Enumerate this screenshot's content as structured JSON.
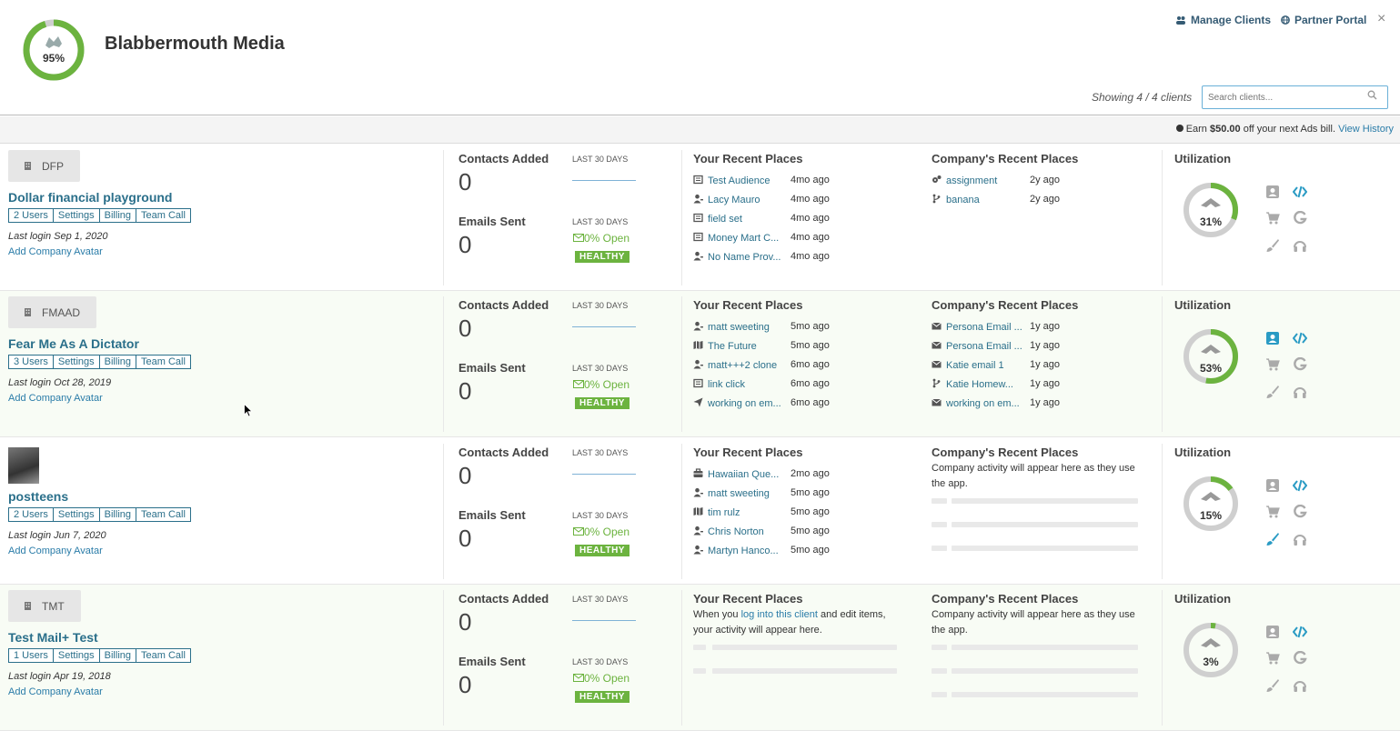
{
  "header": {
    "overall_percent_label": "95%",
    "overall_percent": 95,
    "company": "Blabbermouth Media",
    "manage_clients": "Manage Clients",
    "partner_portal": "Partner Portal",
    "close": "×",
    "showing": "Showing 4 / 4 clients",
    "search_placeholder": "Search clients..."
  },
  "earn_bar": {
    "prefix": "Earn ",
    "amount": "$50.00",
    "suffix": " off your next Ads bill. ",
    "link": "View History"
  },
  "labels": {
    "contacts_added": "Contacts Added",
    "emails_sent": "Emails Sent",
    "last_30_days": "LAST 30 DAYS",
    "your_recent_places": "Your Recent Places",
    "company_recent_places": "Company's Recent Places",
    "utilization": "Utilization",
    "add_company_avatar": "Add Company Avatar",
    "settings": "Settings",
    "billing": "Billing",
    "team_call": "Team Call",
    "healthy": "HEALTHY",
    "open_rate": "0% Open",
    "empty_company": "Company activity will appear here as they use the app.",
    "empty_your_prefix": "When you ",
    "empty_your_link": "log into this client",
    "empty_your_suffix": " and edit items, your activity will appear here."
  },
  "clients": [
    {
      "badge": "DFP",
      "name": "Dollar financial playground",
      "users": "2 Users",
      "last_login": "Last login Sep 1, 2020",
      "contacts": "0",
      "emails": "0",
      "utilization_label": "31%",
      "utilization": 31,
      "your_places": [
        {
          "icon": "list-icon",
          "label": "Test Audience",
          "ago": "4mo ago"
        },
        {
          "icon": "person-icon",
          "label": "Lacy Mauro",
          "ago": "4mo ago"
        },
        {
          "icon": "list-icon",
          "label": "field set",
          "ago": "4mo ago"
        },
        {
          "icon": "list-icon",
          "label": "Money Mart C...",
          "ago": "4mo ago"
        },
        {
          "icon": "person-icon",
          "label": "No Name Prov...",
          "ago": "4mo ago"
        }
      ],
      "company_places": [
        {
          "icon": "gears-icon",
          "label": "assignment",
          "ago": "2y ago"
        },
        {
          "icon": "branch-icon",
          "label": "banana",
          "ago": "2y ago"
        }
      ]
    },
    {
      "badge": "FMAAD",
      "name": "Fear Me As A Dictator",
      "users": "3 Users",
      "last_login": "Last login Oct 28, 2019",
      "contacts": "0",
      "emails": "0",
      "utilization_label": "53%",
      "utilization": 53,
      "your_places": [
        {
          "icon": "person-icon",
          "label": "matt sweeting",
          "ago": "5mo ago"
        },
        {
          "icon": "map-icon",
          "label": "The Future",
          "ago": "5mo ago"
        },
        {
          "icon": "person-icon",
          "label": "matt+++2 clone",
          "ago": "6mo ago"
        },
        {
          "icon": "list-icon",
          "label": "link click",
          "ago": "6mo ago"
        },
        {
          "icon": "send-icon",
          "label": "working on em...",
          "ago": "6mo ago"
        }
      ],
      "company_places": [
        {
          "icon": "envelope-icon",
          "label": "Persona Email ...",
          "ago": "1y ago"
        },
        {
          "icon": "envelope-icon",
          "label": "Persona Email ...",
          "ago": "1y ago"
        },
        {
          "icon": "envelope-icon",
          "label": "Katie email 1",
          "ago": "1y ago"
        },
        {
          "icon": "branch-icon",
          "label": "Katie Homew...",
          "ago": "1y ago"
        },
        {
          "icon": "envelope-icon",
          "label": "working on em...",
          "ago": "1y ago"
        }
      ]
    },
    {
      "badge": "",
      "name": "postteens",
      "users": "2 Users",
      "last_login": "Last login Jun 7, 2020",
      "contacts": "0",
      "emails": "0",
      "utilization_label": "15%",
      "utilization": 15,
      "your_places": [
        {
          "icon": "briefcase-icon",
          "label": "Hawaiian Que...",
          "ago": "2mo ago"
        },
        {
          "icon": "person-icon",
          "label": "matt sweeting",
          "ago": "5mo ago"
        },
        {
          "icon": "map-icon",
          "label": "tim rulz",
          "ago": "5mo ago"
        },
        {
          "icon": "person-icon",
          "label": "Chris Norton",
          "ago": "5mo ago"
        },
        {
          "icon": "person-icon",
          "label": "Martyn Hanco...",
          "ago": "5mo ago"
        }
      ],
      "company_places": []
    },
    {
      "badge": "TMT",
      "name": "Test Mail+ Test",
      "users": "1 Users",
      "last_login": "Last login Apr 19, 2018",
      "contacts": "0",
      "emails": "0",
      "utilization_label": "3%",
      "utilization": 3,
      "your_places": [],
      "company_places": []
    }
  ],
  "colors": {
    "accent_green": "#6cb33f",
    "link_blue": "#2a6f8a",
    "ring_gray": "#cfcfcf"
  }
}
